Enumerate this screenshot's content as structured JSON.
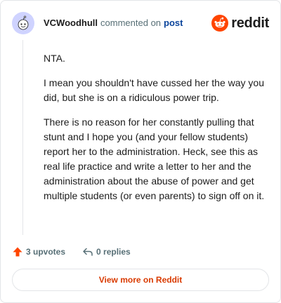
{
  "header": {
    "username": "VCWoodhull",
    "action_text": "commented on",
    "post_link": "post",
    "brand": "reddit"
  },
  "comment": {
    "paragraphs": [
      "NTA.",
      "I mean you shouldn't have cussed her the way you did, but she is on a ridiculous power trip.",
      "There is no reason for her constantly pulling that stunt and I hope you (and your fellow students) report her to the administration. Heck, see this as real life practice and write a letter to her and the administration about the abuse of power and get multiple students (or even parents) to sign off on it."
    ]
  },
  "actions": {
    "upvotes": "3 upvotes",
    "replies": "0 replies"
  },
  "footer": {
    "view_more": "View more on Reddit"
  },
  "colors": {
    "brand_orange": "#ff4500",
    "link_blue": "#0a449b",
    "view_more": "#d93a00"
  }
}
